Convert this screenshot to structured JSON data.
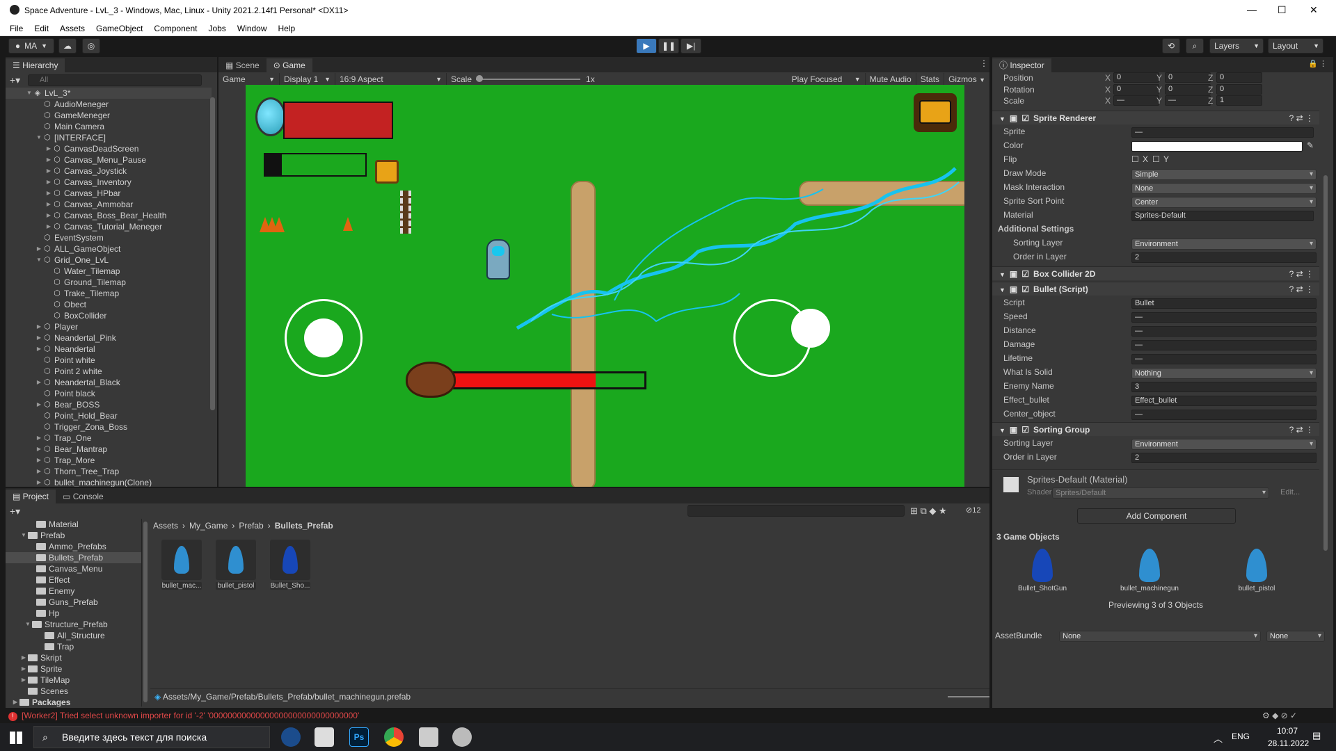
{
  "window": {
    "title": "Space Adventure - LvL_3 - Windows, Mac, Linux - Unity 2021.2.14f1 Personal* <DX11>",
    "minimize": "—",
    "maximize": "☐",
    "close": "✕"
  },
  "menu": [
    "File",
    "Edit",
    "Assets",
    "GameObject",
    "Component",
    "Jobs",
    "Window",
    "Help"
  ],
  "toolbar": {
    "account": "MA",
    "layers": "Layers",
    "layout": "Layout"
  },
  "hierarchy": {
    "tab": "Hierarchy",
    "search_placeholder": "All",
    "items": [
      {
        "label": "LvL_3*",
        "depth": 0,
        "arrow": "▼",
        "icon": "unity"
      },
      {
        "label": "AudioMeneger",
        "depth": 1,
        "arrow": "",
        "icon": "cube"
      },
      {
        "label": "GameMeneger",
        "depth": 1,
        "arrow": "",
        "icon": "cube"
      },
      {
        "label": "Main Camera",
        "depth": 1,
        "arrow": "",
        "icon": "cube"
      },
      {
        "label": "[INTERFACE]",
        "depth": 1,
        "arrow": "▼",
        "icon": "cube"
      },
      {
        "label": "CanvasDeadScreen",
        "depth": 2,
        "arrow": "▶",
        "icon": "cube"
      },
      {
        "label": "Canvas_Menu_Pause",
        "depth": 2,
        "arrow": "▶",
        "icon": "cube"
      },
      {
        "label": "Canvas_Joystick",
        "depth": 2,
        "arrow": "▶",
        "icon": "cube"
      },
      {
        "label": "Canvas_Inventory",
        "depth": 2,
        "arrow": "▶",
        "icon": "cube"
      },
      {
        "label": "Canvas_HPbar",
        "depth": 2,
        "arrow": "▶",
        "icon": "cube"
      },
      {
        "label": "Canvas_Ammobar",
        "depth": 2,
        "arrow": "▶",
        "icon": "cube"
      },
      {
        "label": "Canvas_Boss_Bear_Health",
        "depth": 2,
        "arrow": "▶",
        "icon": "cube"
      },
      {
        "label": "Canvas_Tutorial_Meneger",
        "depth": 2,
        "arrow": "▶",
        "icon": "cube"
      },
      {
        "label": "EventSystem",
        "depth": 1,
        "arrow": "",
        "icon": "cube"
      },
      {
        "label": "ALL_GameObject",
        "depth": 1,
        "arrow": "▶",
        "icon": "cube"
      },
      {
        "label": "Grid_One_LvL",
        "depth": 1,
        "arrow": "▼",
        "icon": "cube"
      },
      {
        "label": "Water_Tilemap",
        "depth": 2,
        "arrow": "",
        "icon": "cube"
      },
      {
        "label": "Ground_Tilemap",
        "depth": 2,
        "arrow": "",
        "icon": "cube"
      },
      {
        "label": "Trake_Tilemap",
        "depth": 2,
        "arrow": "",
        "icon": "cube"
      },
      {
        "label": "Obect",
        "depth": 2,
        "arrow": "",
        "icon": "cube"
      },
      {
        "label": "BoxCollider",
        "depth": 2,
        "arrow": "",
        "icon": "cube"
      },
      {
        "label": "Player",
        "depth": 1,
        "arrow": "▶",
        "icon": "cube"
      },
      {
        "label": "Neandertal_Pink",
        "depth": 1,
        "arrow": "▶",
        "icon": "cube"
      },
      {
        "label": "Neandertal",
        "depth": 1,
        "arrow": "▶",
        "icon": "cube"
      },
      {
        "label": "Point white",
        "depth": 1,
        "arrow": "",
        "icon": "cube"
      },
      {
        "label": "Point 2 white",
        "depth": 1,
        "arrow": "",
        "icon": "cube"
      },
      {
        "label": "Neandertal_Black",
        "depth": 1,
        "arrow": "▶",
        "icon": "cube"
      },
      {
        "label": "Point black",
        "depth": 1,
        "arrow": "",
        "icon": "cube"
      },
      {
        "label": "Bear_BOSS",
        "depth": 1,
        "arrow": "▶",
        "icon": "cube"
      },
      {
        "label": "Point_Hold_Bear",
        "depth": 1,
        "arrow": "",
        "icon": "cube"
      },
      {
        "label": "Trigger_Zona_Boss",
        "depth": 1,
        "arrow": "",
        "icon": "cube"
      },
      {
        "label": "Trap_One",
        "depth": 1,
        "arrow": "▶",
        "icon": "cube"
      },
      {
        "label": "Bear_Mantrap",
        "depth": 1,
        "arrow": "▶",
        "icon": "cube"
      },
      {
        "label": "Trap_More",
        "depth": 1,
        "arrow": "▶",
        "icon": "cube"
      },
      {
        "label": "Thorn_Tree_Trap",
        "depth": 1,
        "arrow": "▶",
        "icon": "cube"
      },
      {
        "label": "bullet_machinegun(Clone)",
        "depth": 1,
        "arrow": "▶",
        "icon": "cube"
      }
    ]
  },
  "view_tabs": {
    "scene": "Scene",
    "game": "Game"
  },
  "gamebar": {
    "mode": "Game",
    "display": "Display 1",
    "aspect": "16:9 Aspect",
    "scale_label": "Scale",
    "scale_value": "1x",
    "play_focused": "Play Focused",
    "mute": "Mute Audio",
    "stats": "Stats",
    "gizmos": "Gizmos"
  },
  "game": {
    "player_hp": 1.0,
    "ammo": 0.17,
    "boss_hp": 0.75
  },
  "inspector": {
    "tab": "Inspector",
    "transform": [
      {
        "label": "Position",
        "x": "0",
        "y": "0",
        "z": "0"
      },
      {
        "label": "Rotation",
        "x": "0",
        "y": "0",
        "z": "0"
      },
      {
        "label": "Scale",
        "x": "—",
        "y": "—",
        "z": "1"
      }
    ],
    "sprite_renderer": {
      "title": "Sprite Renderer",
      "sprite_label": "Sprite",
      "sprite_value": "—",
      "color_label": "Color",
      "flip_label": "Flip",
      "flip_x": "X",
      "flip_y": "Y",
      "draw_mode_label": "Draw Mode",
      "draw_mode": "Simple",
      "mask_label": "Mask Interaction",
      "mask": "None",
      "sort_point_label": "Sprite Sort Point",
      "sort_point": "Center",
      "material_label": "Material",
      "material": "Sprites-Default",
      "additional": "Additional Settings",
      "sorting_layer_label": "Sorting Layer",
      "sorting_layer": "Environment",
      "order_label": "Order in Layer",
      "order": "2"
    },
    "box_collider": {
      "title": "Box Collider 2D"
    },
    "bullet": {
      "title": "Bullet (Script)",
      "script_label": "Script",
      "script": "Bullet",
      "speed_label": "Speed",
      "speed": "—",
      "distance_label": "Distance",
      "distance": "—",
      "damage_label": "Damage",
      "damage": "—",
      "lifetime_label": "Lifetime",
      "lifetime": "—",
      "solid_label": "What Is Solid",
      "solid": "Nothing",
      "enemy_label": "Enemy Name",
      "enemy": "3",
      "effect_label": "Effect_bullet",
      "effect": "Effect_bullet",
      "center_label": "Center_object",
      "center": "—"
    },
    "sorting_group": {
      "title": "Sorting Group",
      "layer_label": "Sorting Layer",
      "layer": "Environment",
      "order_label": "Order in Layer",
      "order": "2"
    },
    "material": {
      "name": "Sprites-Default (Material)",
      "shader_label": "Shader",
      "shader": "Sprites/Default",
      "edit": "Edit..."
    },
    "add_component": "Add Component",
    "preview_header": "3 Game Objects",
    "preview_items": [
      "Bullet_ShotGun",
      "bullet_machinegun",
      "bullet_pistol"
    ],
    "preview_caption": "Previewing 3 of 3 Objects",
    "assetbundle_label": "AssetBundle",
    "assetbundle": "None",
    "variant": "None"
  },
  "project": {
    "tab_project": "Project",
    "tab_console": "Console",
    "hidden_count": "12",
    "tree": [
      {
        "label": "Material",
        "depth": 2,
        "arrow": ""
      },
      {
        "label": "Prefab",
        "depth": 1,
        "arrow": "▼"
      },
      {
        "label": "Ammo_Prefabs",
        "depth": 2,
        "arrow": ""
      },
      {
        "label": "Bullets_Prefab",
        "depth": 2,
        "arrow": "",
        "selected": true
      },
      {
        "label": "Canvas_Menu",
        "depth": 2,
        "arrow": ""
      },
      {
        "label": "Effect",
        "depth": 2,
        "arrow": ""
      },
      {
        "label": "Enemy",
        "depth": 2,
        "arrow": ""
      },
      {
        "label": "Guns_Prefab",
        "depth": 2,
        "arrow": ""
      },
      {
        "label": "Hp",
        "depth": 2,
        "arrow": ""
      },
      {
        "label": "Structure_Prefab",
        "depth": 1.5,
        "arrow": "▼"
      },
      {
        "label": "All_Structure",
        "depth": 3,
        "arrow": ""
      },
      {
        "label": "Trap",
        "depth": 3,
        "arrow": ""
      },
      {
        "label": "Skript",
        "depth": 1,
        "arrow": "▶"
      },
      {
        "label": "Sprite",
        "depth": 1,
        "arrow": "▶"
      },
      {
        "label": "TileMap",
        "depth": 1,
        "arrow": "▶"
      },
      {
        "label": "Scenes",
        "depth": 1,
        "arrow": ""
      },
      {
        "label": "Packages",
        "depth": 0,
        "arrow": "▶",
        "bold": true
      }
    ],
    "breadcrumb": [
      "Assets",
      "My_Game",
      "Prefab",
      "Bullets_Prefab"
    ],
    "assets": [
      {
        "label": "bullet_mac...",
        "color": "#2f8fd0"
      },
      {
        "label": "bullet_pistol",
        "color": "#2f8fd0"
      },
      {
        "label": "Bullet_Sho...",
        "color": "#1747b8"
      }
    ],
    "path": "Assets/My_Game/Prefab/Bullets_Prefab/bullet_machinegun.prefab"
  },
  "status": {
    "error": "[Worker2] Tried select unknown importer for id '-2' '00000000000000000000000000000000'"
  },
  "taskbar": {
    "search": "Введите здесь текст для поиска",
    "lang": "ENG",
    "time": "10:07",
    "date": "28.11.2022"
  }
}
